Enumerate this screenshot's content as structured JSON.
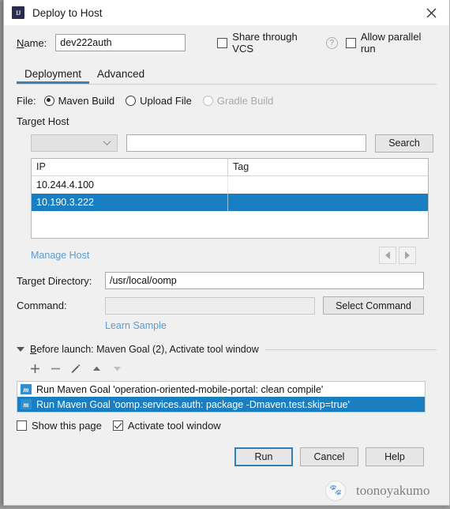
{
  "window": {
    "title": "Deploy to Host",
    "app_icon": "intellij-idea-icon",
    "close_icon": "close-icon"
  },
  "name_field": {
    "label": "Name:",
    "label_mnemonic": "N",
    "value": "dev222auth"
  },
  "options": {
    "share_vcs": {
      "label": "Share through VCS",
      "checked": false,
      "mnemonic": "S"
    },
    "help_icon": "?",
    "allow_parallel": {
      "label": "Allow parallel run",
      "checked": false
    }
  },
  "tabs": [
    {
      "label": "Deployment",
      "active": true
    },
    {
      "label": "Advanced",
      "active": false
    }
  ],
  "file_row": {
    "label": "File:",
    "options": [
      {
        "label": "Maven Build",
        "selected": true,
        "disabled": false
      },
      {
        "label": "Upload File",
        "selected": false,
        "disabled": false
      },
      {
        "label": "Gradle Build",
        "selected": false,
        "disabled": true
      }
    ]
  },
  "target_host": {
    "section_label": "Target Host",
    "filter_select": {
      "value": "",
      "icon": "chevron-down-icon"
    },
    "search_input": {
      "value": "",
      "placeholder": ""
    },
    "search_button": "Search",
    "table": {
      "columns": [
        "IP",
        "Tag"
      ],
      "rows": [
        {
          "ip": "10.244.4.100",
          "tag": "",
          "selected": false
        },
        {
          "ip": "10.190.3.222",
          "tag": "",
          "selected": true
        }
      ]
    },
    "manage_host_link": "Manage Host",
    "pager": {
      "prev_icon": "triangle-left-icon",
      "next_icon": "triangle-right-icon"
    }
  },
  "target_directory": {
    "label": "Target Directory:",
    "value": "/usr/local/oomp"
  },
  "command": {
    "label": "Command:",
    "value": "",
    "button": "Select Command",
    "learn_sample_link": "Learn Sample"
  },
  "before_launch": {
    "title": "Before launch: Maven Goal (2), Activate tool window",
    "title_mnemonic": "B",
    "collapse_icon": "triangle-down-icon",
    "toolbar": [
      {
        "name": "add-icon",
        "glyph": "+",
        "disabled": false
      },
      {
        "name": "remove-icon",
        "glyph": "−",
        "disabled": false
      },
      {
        "name": "edit-pencil-icon",
        "glyph": "✎",
        "disabled": false
      },
      {
        "name": "move-up-icon",
        "glyph": "▲",
        "disabled": false
      },
      {
        "name": "move-down-icon",
        "glyph": "▼",
        "disabled": true
      }
    ],
    "items": [
      {
        "icon": "maven-icon",
        "icon_letter": "m",
        "text": "Run Maven Goal 'operation-oriented-mobile-portal: clean compile'",
        "selected": false
      },
      {
        "icon": "maven-icon",
        "icon_letter": "m",
        "text": "Run Maven Goal 'oomp.services.auth: package -Dmaven.test.skip=true'",
        "selected": true
      }
    ]
  },
  "bottom_options": {
    "show_this_page": {
      "label": "Show this page",
      "checked": false
    },
    "activate_tool_window": {
      "label": "Activate tool window",
      "checked": true
    }
  },
  "buttons": {
    "run": "Run",
    "cancel": "Cancel",
    "help": "Help"
  },
  "watermark": {
    "text": "toonoyakumo"
  },
  "colors": {
    "selection_blue": "#1a7ec2",
    "tab_underline": "#3e7fb5",
    "link_blue": "#5a9bd4",
    "maven_icon": "#2f8fd0",
    "dialog_bg": "#f0f0f0"
  }
}
